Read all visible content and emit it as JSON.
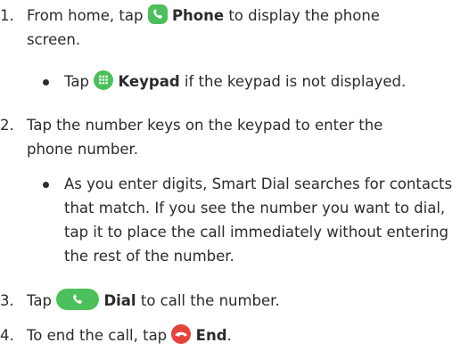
{
  "steps": [
    {
      "number": "1.",
      "before": "From home, tap",
      "icon": "phone-app-icon",
      "bold": "Phone",
      "after": "to display the phone screen.",
      "sub": {
        "before": "Tap",
        "icon": "keypad-icon",
        "bold": "Keypad",
        "after": "if the keypad is not displayed."
      }
    },
    {
      "number": "2.",
      "text": "Tap the number keys on the keypad to enter the phone number.",
      "sub": {
        "text": "As you enter digits, Smart Dial searches for contacts that match. If you see the number you want to dial, tap it to place the call immediately without entering the rest of the number."
      }
    },
    {
      "number": "3.",
      "before": "Tap",
      "icon": "dial-button-icon",
      "bold": "Dial",
      "after": "to call the number."
    },
    {
      "number": "4.",
      "before": "To end the call, tap",
      "icon": "end-call-icon",
      "bold": "End",
      "after": "."
    }
  ],
  "colors": {
    "green": "#4cc05a",
    "red": "#e8433b",
    "text": "#2b2b2b"
  }
}
